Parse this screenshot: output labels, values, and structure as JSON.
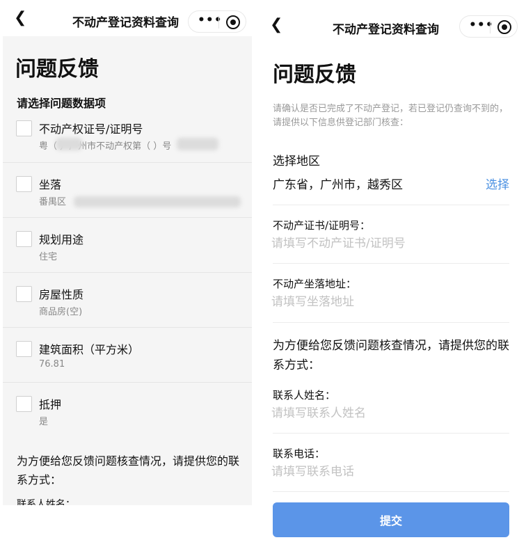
{
  "left_screen": {
    "nav": {
      "back_icon": "chevron-left-icon",
      "title": "不动产登记资料查询",
      "more_icon": "more-dots-icon",
      "close_icon": "target-icon"
    },
    "page_title": "问题反馈",
    "section_label": "请选择问题数据项",
    "items": [
      {
        "label": "不动产权证号/证明号",
        "value": "粤（ ）广州市不动产权第（ ）号",
        "value_partially_redacted": true
      },
      {
        "label": "坐落",
        "value": "番禺区",
        "value_partially_redacted": true
      },
      {
        "label": "规划用途",
        "value": "住宅"
      },
      {
        "label": "房屋性质",
        "value": "商品房(空)"
      },
      {
        "label": "建筑面积（平方米）",
        "value": "76.81"
      },
      {
        "label": "抵押",
        "value": "是"
      }
    ],
    "contact_prompt": "为方便给您反馈问题核查情况，请提供您的联系方式：",
    "cut_off_label": "联系人姓名："
  },
  "right_screen": {
    "nav": {
      "back_icon": "chevron-left-icon",
      "title": "不动产登记资料查询",
      "more_icon": "more-dots-icon",
      "close_icon": "target-icon"
    },
    "page_title": "问题反馈",
    "tip": "请确认是否已完成了不动产登记，若已登记仍查询不到的，请提供以下信息供登记部门核查：",
    "region": {
      "label": "选择地区",
      "value": "广东省，广州市，越秀区",
      "select_label": "选择"
    },
    "cert_field": {
      "label": "不动产证书/证明号：",
      "placeholder": "请填写不动产证书/证明号",
      "value": ""
    },
    "address_field": {
      "label": "不动产坐落地址：",
      "placeholder": "请填写坐落地址",
      "value": ""
    },
    "contact_prompt": "为方便给您反馈问题核查情况，请提供您的联系方式：",
    "name_field": {
      "label": "联系人姓名：",
      "placeholder": "请填写联系人姓名",
      "value": ""
    },
    "phone_field": {
      "label": "联系电话：",
      "placeholder": "请填写联系电话",
      "value": ""
    },
    "submit_label": "提交"
  },
  "colors": {
    "accent": "#4a90e2",
    "submit_bg": "#5b95e8",
    "placeholder": "#c2c2c2",
    "hint": "#999999",
    "panel_bg": "#f5f5f5"
  }
}
